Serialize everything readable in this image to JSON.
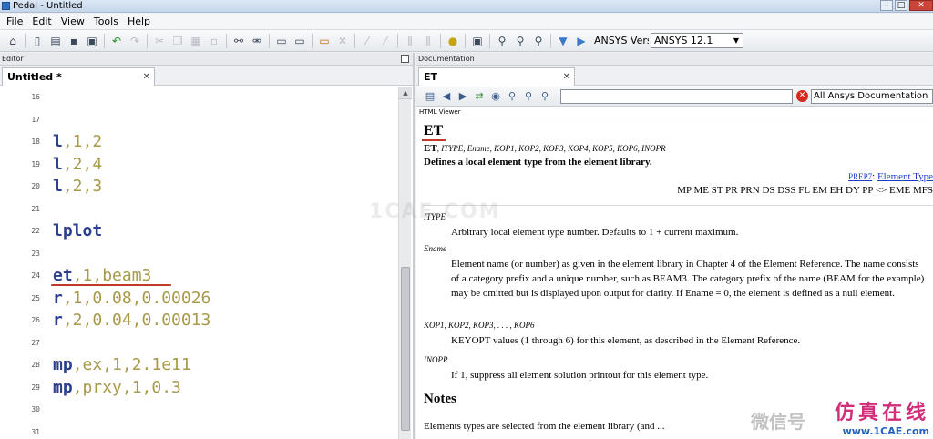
{
  "window": {
    "title": "Pedal - Untitled"
  },
  "menu": [
    "File",
    "Edit",
    "View",
    "Tools",
    "Help"
  ],
  "toolbar": {
    "version_label": "ANSYS Version",
    "version_selected": "ANSYS 12.1"
  },
  "editor": {
    "pane_title": "Editor",
    "tab_label": "Untitled *",
    "lines": [
      {
        "num": "16",
        "cmd": "",
        "args": ""
      },
      {
        "num": "17",
        "cmd": "",
        "args": ""
      },
      {
        "num": "18",
        "cmd": "l",
        "args": ",1,2"
      },
      {
        "num": "19",
        "cmd": "l",
        "args": ",2,4"
      },
      {
        "num": "20",
        "cmd": "l",
        "args": ",2,3"
      },
      {
        "num": "21",
        "cmd": "",
        "args": ""
      },
      {
        "num": "22",
        "cmd": "lplot",
        "args": ""
      },
      {
        "num": "23",
        "cmd": "",
        "args": ""
      },
      {
        "num": "24",
        "cmd": "et",
        "args": ",1,beam3"
      },
      {
        "num": "25",
        "cmd": "r",
        "args": ",1,0.08,0.00026"
      },
      {
        "num": "26",
        "cmd": "r",
        "args": ",2,0.04,0.00013"
      },
      {
        "num": "27",
        "cmd": "",
        "args": ""
      },
      {
        "num": "28",
        "cmd": "mp",
        "args": ",ex,1,2.1e11"
      },
      {
        "num": "29",
        "cmd": "mp",
        "args": ",prxy,1,0.3"
      },
      {
        "num": "30",
        "cmd": "",
        "args": ""
      },
      {
        "num": "31",
        "cmd": "",
        "args": ""
      }
    ]
  },
  "documentation": {
    "pane_title": "Documentation",
    "tab_label": "ET",
    "viewer_label": "HTML Viewer",
    "search_value": "",
    "scope": "All Ansys Documentation",
    "heading": "ET",
    "signature_cmd": "ET",
    "signature_rest": ", ITYPE, Ename, KOP1, KOP2, KOP3, KOP4, KOP5, KOP6, INOPR",
    "description": "Defines a local element type from the element library.",
    "prep7": "PREP7",
    "prep7_sep": ": ",
    "prep7_link": "Element Type",
    "products": "MP ME ST PR PRN DS DSS FL EM EH DY PP <> EME MFS",
    "args": [
      {
        "name": "ITYPE",
        "desc": "Arbitrary local element type number. Defaults to 1 + current maximum."
      },
      {
        "name": "Ename",
        "desc": "Element name (or number) as given in the element library in Chapter 4 of the Element Reference. The name consists of a category prefix and a unique number, such as BEAM3. The category prefix of the name (BEAM for the example) may be omitted but is displayed upon output for clarity. If Ename = 0, the element is defined as a null element."
      },
      {
        "name": "KOP1, KOP2, KOP3, . . . , KOP6",
        "desc": "KEYOPT values (1 through 6) for this element, as described in the Element Reference."
      },
      {
        "name": "INOPR",
        "desc": "If 1, suppress all element solution printout for this element type."
      }
    ],
    "notes_heading": "Notes",
    "notes_text": "Elements types are selected from the element library (and ..."
  },
  "watermark": "1CAE.COM",
  "brand": {
    "faint": "微信号",
    "main": "仿真在线",
    "sub": "www.1CAE.com"
  }
}
